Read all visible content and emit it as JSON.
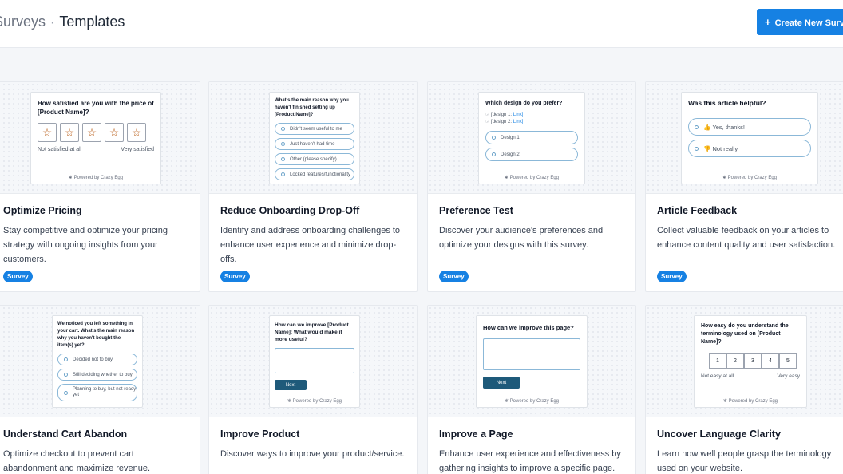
{
  "header": {
    "breadcrumb_parent": "Surveys",
    "breadcrumb_current": "Templates",
    "create_button": "Create New Survey"
  },
  "badge_label": "Survey",
  "powered_by": "Powered by Crazy Egg",
  "cards": [
    {
      "title": "Optimize Pricing",
      "description": "Stay competitive and optimize your pricing strategy with ongoing insights from your customers.",
      "preview": {
        "question": "How satisfied are you with the price of [Product Name]?",
        "low_label": "Not satisfied at all",
        "high_label": "Very satisfied"
      }
    },
    {
      "title": "Reduce Onboarding Drop-Off",
      "description": "Identify and address onboarding challenges to enhance user experience and minimize drop-offs.",
      "preview": {
        "question": "What's the main reason why you haven't finished setting up [Product Name]?",
        "options": [
          "Didn't seem useful to me",
          "Just haven't had time",
          "Other (please specify)",
          "Locked features/functionality"
        ]
      }
    },
    {
      "title": "Preference Test",
      "description": "Discover your audience's preferences and optimize your designs with this survey.",
      "preview": {
        "question": "Which design do you prefer?",
        "design1_label": "[design 1:",
        "design2_label": "[design 2:",
        "link_text": "Link]",
        "options": [
          "Design 1",
          "Design 2"
        ]
      }
    },
    {
      "title": "Article Feedback",
      "description": "Collect valuable feedback on your articles to enhance content quality and user satisfaction.",
      "preview": {
        "question": "Was this article helpful?",
        "options": [
          "Yes, thanks!",
          "Not really"
        ]
      }
    },
    {
      "title": "Understand Cart Abandon",
      "description": "Optimize checkout to prevent cart abandonment and maximize revenue.",
      "preview": {
        "question": "We noticed you left something in your cart. What's the main reason why you haven't bought the item(s) yet?",
        "options": [
          "Decided not to buy",
          "Still deciding whether to buy",
          "Planning to buy, but not ready yet"
        ]
      }
    },
    {
      "title": "Improve Product",
      "description": "Discover ways to improve your product/service.",
      "preview": {
        "question": "How can we improve [Product Name]: What would make it more useful?",
        "next_label": "Next"
      }
    },
    {
      "title": "Improve a Page",
      "description": "Enhance user experience and effectiveness by gathering insights to improve a specific page.",
      "preview": {
        "question": "How can we improve this page?",
        "next_label": "Next"
      }
    },
    {
      "title": "Uncover Language Clarity",
      "description": "Learn how well people grasp the terminology used on your website.",
      "preview": {
        "question": "How easy do you understand the terminology used on [Product Name]?",
        "scale": [
          "1",
          "2",
          "3",
          "4",
          "5"
        ],
        "low_label": "Not easy at all",
        "high_label": "Very easy"
      }
    }
  ]
}
